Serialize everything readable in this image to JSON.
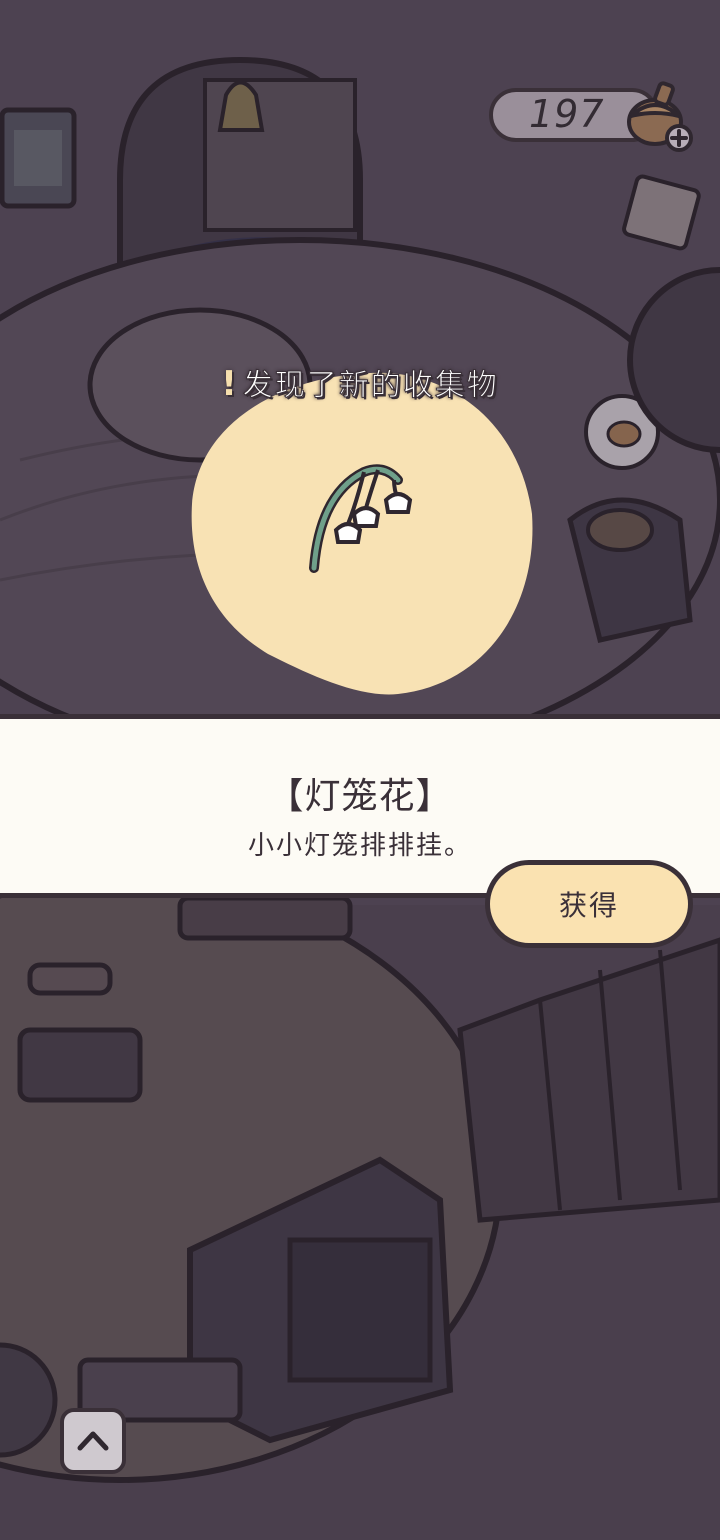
{
  "currency": {
    "value": "197",
    "icon": "acorn-plus-icon"
  },
  "notice": {
    "mark": "!",
    "text": "发现了新的收集物"
  },
  "item": {
    "icon": "lily-of-the-valley-icon",
    "name": "【灯笼花】",
    "description": "小小灯笼排排挂。"
  },
  "actions": {
    "obtain_label": "获得",
    "expand_icon": "chevron-up-icon"
  },
  "colors": {
    "panel_bg": "#fdfbf5",
    "button_bg": "#fae2b1",
    "blob_bg": "#f8e2b4",
    "outline": "#3a3038"
  }
}
